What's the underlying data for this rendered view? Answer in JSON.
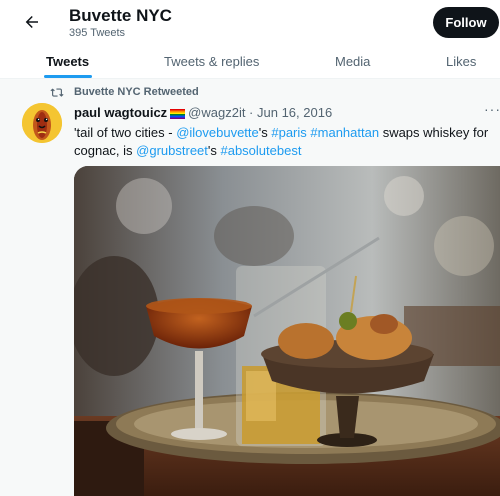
{
  "header": {
    "back_icon": "arrow-left-icon",
    "title": "Buvette NYC",
    "subtitle": "395 Tweets",
    "follow_label": "Follow"
  },
  "tabs": [
    {
      "label": "Tweets",
      "active": true
    },
    {
      "label": "Tweets & replies",
      "active": false
    },
    {
      "label": "Media",
      "active": false
    },
    {
      "label": "Likes",
      "active": false
    }
  ],
  "tweet": {
    "retweet_icon": "retweet-icon",
    "retweet_text": "Buvette NYC Retweeted",
    "author_name": "paul wagtouicz",
    "author_flag_icon": "rainbow-flag-icon",
    "handle_date": "@wagz2it · Jun 16, 2016",
    "more_icon": "more-icon",
    "text_parts": [
      {
        "text": "'tail of two cities - ",
        "link": false
      },
      {
        "text": "@ilovebuvette",
        "link": true
      },
      {
        "text": "'s ",
        "link": false
      },
      {
        "text": "#paris",
        "link": true
      },
      {
        "text": " ",
        "link": false
      },
      {
        "text": "#manhattan",
        "link": true
      },
      {
        "text": " swaps whiskey for cognac, is ",
        "link": false
      },
      {
        "text": "@grubstreet",
        "link": true
      },
      {
        "text": "'s ",
        "link": false
      },
      {
        "text": "#absolutebest",
        "link": true
      }
    ]
  },
  "colors": {
    "accent": "#1d9bf0",
    "text": "#0f1419",
    "muted": "#536471",
    "follow_bg": "#0f1419"
  }
}
